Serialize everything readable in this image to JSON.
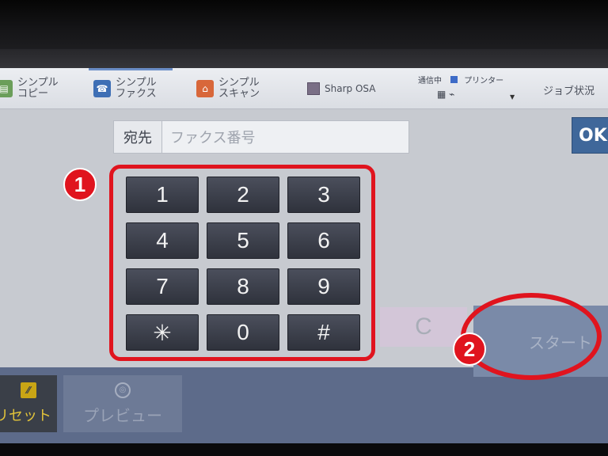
{
  "nav": {
    "items": [
      {
        "label": "シンプル\nコピー",
        "icon": "copy-icon"
      },
      {
        "label": "シンプル\nファクス",
        "icon": "fax-icon"
      },
      {
        "label": "シンプル\nスキャン",
        "icon": "scan-icon"
      },
      {
        "label": "Sharp OSA",
        "icon": "osa-icon"
      }
    ],
    "status_line": "通信中",
    "printer_label": "プリンター",
    "job_status": "ジョブ状況"
  },
  "dest": {
    "label": "宛先",
    "placeholder": "ファクス番号"
  },
  "ok_label": "OK",
  "keypad": {
    "keys": [
      "1",
      "2",
      "3",
      "4",
      "5",
      "6",
      "7",
      "8",
      "9",
      "✳",
      "0",
      "#"
    ]
  },
  "clear_label": "C",
  "markers": [
    "1",
    "2"
  ],
  "bottom": {
    "reset_label": "リセット",
    "preview_label": "プレビュー",
    "start_label": "スタート"
  },
  "colors": {
    "highlight": "#e0141e",
    "ok_blue": "#3f679a",
    "key_dark": "#2f323c"
  }
}
